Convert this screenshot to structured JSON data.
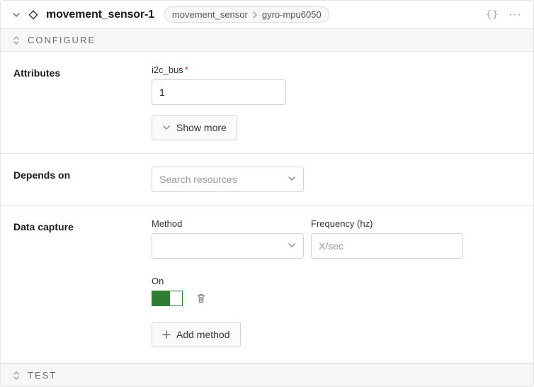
{
  "header": {
    "title": "movement_sensor-1",
    "breadcrumb": {
      "type": "movement_sensor",
      "model": "gyro-mpu6050"
    }
  },
  "sections": {
    "configure_label": "CONFIGURE",
    "test_label": "TEST"
  },
  "attributes": {
    "section_label": "Attributes",
    "i2c_bus": {
      "label": "i2c_bus",
      "value": "1"
    },
    "show_more_label": "Show more"
  },
  "depends_on": {
    "section_label": "Depends on",
    "search_placeholder": "Search resources"
  },
  "data_capture": {
    "section_label": "Data capture",
    "method_label": "Method",
    "frequency_label": "Frequency (hz)",
    "frequency_placeholder": "X/sec",
    "on_label": "On",
    "on_value": true,
    "add_method_label": "Add method"
  },
  "colors": {
    "toggle_on": "#2e7d32",
    "border": "#e5e5e5"
  }
}
